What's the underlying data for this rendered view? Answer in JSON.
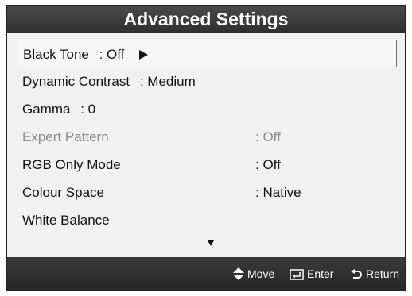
{
  "title": "Advanced Settings",
  "items": [
    {
      "label": "Black Tone",
      "value": ": Off"
    },
    {
      "label": "Dynamic Contrast",
      "value": ": Medium"
    },
    {
      "label": "Gamma",
      "value": ": 0"
    },
    {
      "label": "Expert Pattern",
      "value": ": Off"
    },
    {
      "label": "RGB Only Mode",
      "value": ": Off"
    },
    {
      "label": "Colour Space",
      "value": ": Native"
    },
    {
      "label": "White Balance",
      "value": ""
    }
  ],
  "footer": {
    "move": "Move",
    "enter": "Enter",
    "return": "Return"
  },
  "icons": {
    "move": "up-down-arrow-icon",
    "enter": "enter-icon",
    "return": "return-icon",
    "submenu": "play-arrow-icon",
    "scroll": "scroll-down-icon"
  }
}
